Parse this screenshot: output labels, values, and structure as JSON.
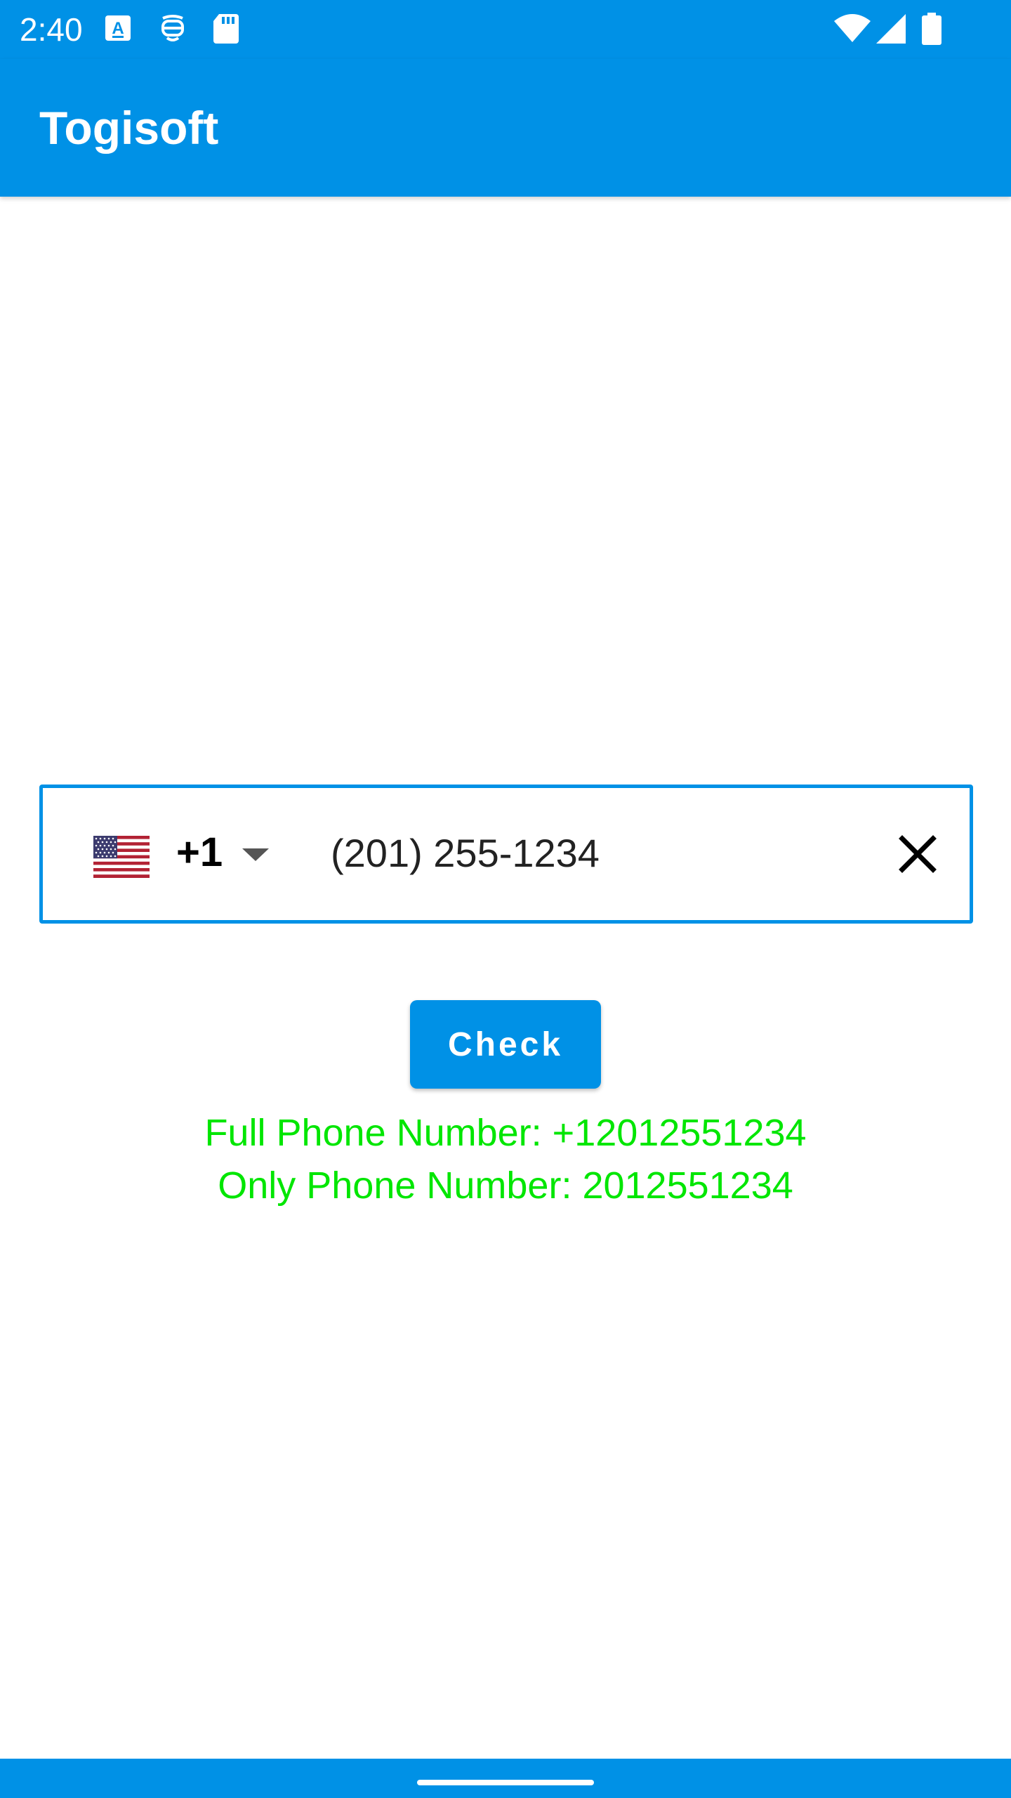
{
  "status_bar": {
    "time": "2:40",
    "left_icons": [
      "font-download-icon",
      "face-mask-icon",
      "sd-card-icon"
    ],
    "right_icons": [
      "wifi-icon",
      "cellular-signal-icon",
      "battery-icon"
    ]
  },
  "app_bar": {
    "title": "Togisoft"
  },
  "phone_field": {
    "country_flag": "us-flag-icon",
    "dial_code": "+1",
    "value": "(201) 255-1234"
  },
  "check_button": {
    "label": "Check"
  },
  "results": {
    "full": "Full Phone Number: +12012551234",
    "only": "Only Phone Number: 2012551234"
  },
  "colors": {
    "primary": "#0091E6",
    "result_text": "#00E600",
    "background": "#FFFFFF"
  }
}
